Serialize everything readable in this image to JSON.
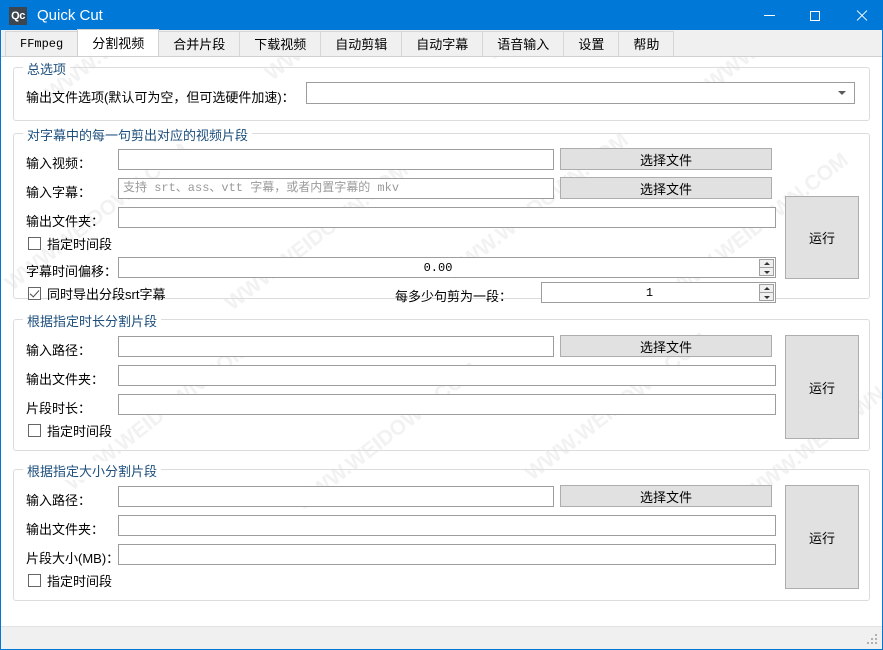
{
  "window": {
    "icon_text": "Qc",
    "title": "Quick Cut",
    "minimize_label": "—",
    "maximize_label": "☐",
    "close_label": "✕"
  },
  "tabs": [
    {
      "label": "FFmpeg",
      "active": false
    },
    {
      "label": "分割视频",
      "active": true
    },
    {
      "label": "合并片段",
      "active": false
    },
    {
      "label": "下载视频",
      "active": false
    },
    {
      "label": "自动剪辑",
      "active": false
    },
    {
      "label": "自动字幕",
      "active": false
    },
    {
      "label": "语音输入",
      "active": false
    },
    {
      "label": "设置",
      "active": false
    },
    {
      "label": "帮助",
      "active": false
    }
  ],
  "general_options": {
    "title": "总选项",
    "output_file_options_label": "输出文件选项(默认可为空，但可选硬件加速)：",
    "output_file_options_value": ""
  },
  "subtitle_cut": {
    "title": "对字幕中的每一句剪出对应的视频片段",
    "input_video_label": "输入视频：",
    "input_video_value": "",
    "input_subtitle_label": "输入字幕：",
    "input_subtitle_value": "",
    "input_subtitle_placeholder": "支持 srt、ass、vtt 字幕，或者内置字幕的 mkv",
    "output_folder_label": "输出文件夹：",
    "output_folder_value": "",
    "specify_timerange_label": "指定时间段",
    "specify_timerange_checked": false,
    "time_offset_label": "字幕时间偏移：",
    "time_offset_value": "0.00",
    "export_srt_label": "同时导出分段srt字幕",
    "export_srt_checked": true,
    "sentences_per_clip_label": "每多少句剪为一段：",
    "sentences_per_clip_value": "1",
    "choose_file_video_label": "选择文件",
    "choose_file_subtitle_label": "选择文件",
    "run_label": "运行"
  },
  "duration_split": {
    "title": "根据指定时长分割片段",
    "input_path_label": "输入路径：",
    "input_path_value": "",
    "output_folder_label": "输出文件夹：",
    "output_folder_value": "",
    "clip_duration_label": "片段时长：",
    "clip_duration_value": "",
    "specify_timerange_label": "指定时间段",
    "specify_timerange_checked": false,
    "choose_file_label": "选择文件",
    "run_label": "运行"
  },
  "size_split": {
    "title": "根据指定大小分割片段",
    "input_path_label": "输入路径：",
    "input_path_value": "",
    "output_folder_label": "输出文件夹：",
    "output_folder_value": "",
    "clip_size_label": "片段大小(MB)：",
    "clip_size_value": "",
    "specify_timerange_label": "指定时间段",
    "specify_timerange_checked": false,
    "choose_file_label": "选择文件",
    "run_label": "运行"
  },
  "watermark": {
    "text": "WWW.WEIDOWN.COM"
  },
  "colors": {
    "titlebar": "#0078d7",
    "group_title": "#1d4f7c",
    "button_face": "#e1e1e1",
    "tab_active": "#ffffff",
    "tab_inactive": "#f0f0f0"
  }
}
